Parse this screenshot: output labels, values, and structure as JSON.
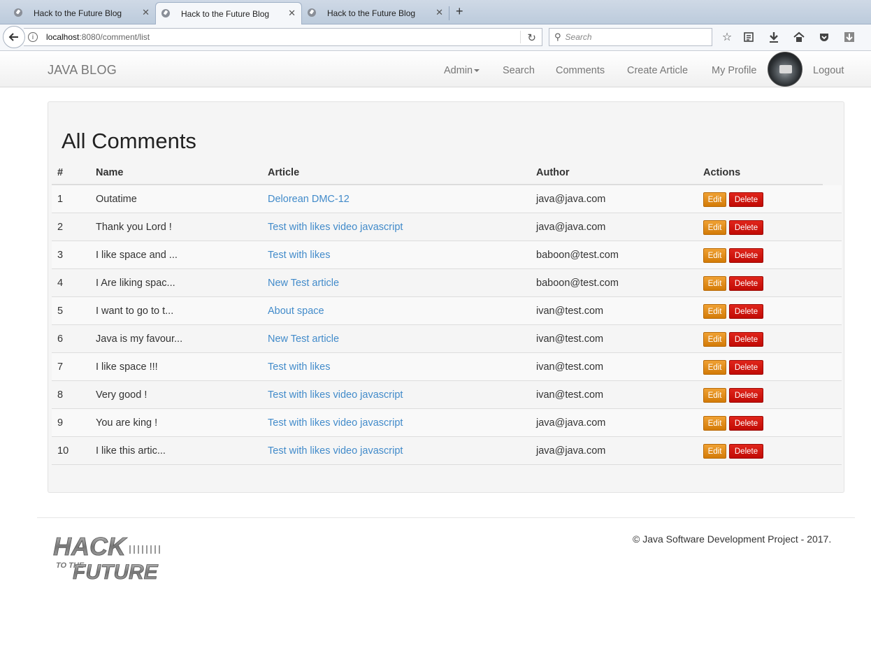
{
  "browser": {
    "tabs": [
      {
        "title": "Hack to the Future Blog"
      },
      {
        "title": "Hack to the Future Blog"
      },
      {
        "title": "Hack to the Future Blog"
      }
    ],
    "url_host": "localhost",
    "url_path": ":8080/comment/list",
    "search_placeholder": "Search"
  },
  "site": {
    "brand": "JAVA BLOG",
    "nav": {
      "admin": "Admin",
      "search": "Search",
      "comments": "Comments",
      "create_article": "Create Article",
      "my_profile": "My Profile",
      "logout": "Logout"
    }
  },
  "page": {
    "title": "All Comments",
    "columns": {
      "num": "#",
      "name": "Name",
      "article": "Article",
      "author": "Author",
      "actions": "Actions"
    },
    "edit_label": "Edit",
    "delete_label": "Delete",
    "rows": [
      {
        "num": "1",
        "name": "Outatime",
        "article": "Delorean DMC-12",
        "author": "java@java.com"
      },
      {
        "num": "2",
        "name": "Thank you Lord !",
        "article": "Test with likes video javascript",
        "author": "java@java.com"
      },
      {
        "num": "3",
        "name": "I like space and ...",
        "article": "Test with likes",
        "author": "baboon@test.com"
      },
      {
        "num": "4",
        "name": "I Are liking spac...",
        "article": "New Test article",
        "author": "baboon@test.com"
      },
      {
        "num": "5",
        "name": "I want to go to t...",
        "article": "About space",
        "author": "ivan@test.com"
      },
      {
        "num": "6",
        "name": "Java is my favour...",
        "article": "New Test article",
        "author": "ivan@test.com"
      },
      {
        "num": "7",
        "name": "I like space !!!",
        "article": "Test with likes",
        "author": "ivan@test.com"
      },
      {
        "num": "8",
        "name": "Very good !",
        "article": "Test with likes video javascript",
        "author": "ivan@test.com"
      },
      {
        "num": "9",
        "name": "You are king !",
        "article": "Test with likes video javascript",
        "author": "java@java.com"
      },
      {
        "num": "10",
        "name": "I like this artic...",
        "article": "Test with likes video javascript",
        "author": "java@java.com"
      }
    ]
  },
  "footer": {
    "copyright": "© Java Software Development Project - 2017.",
    "logo_line1": "HACK",
    "logo_line2": "TO THE",
    "logo_line3": "FUTURE"
  },
  "colors": {
    "link": "#428bca",
    "edit_button": "#e08e1b",
    "delete_button": "#cc0f08",
    "panel_bg": "#f5f5f5"
  }
}
